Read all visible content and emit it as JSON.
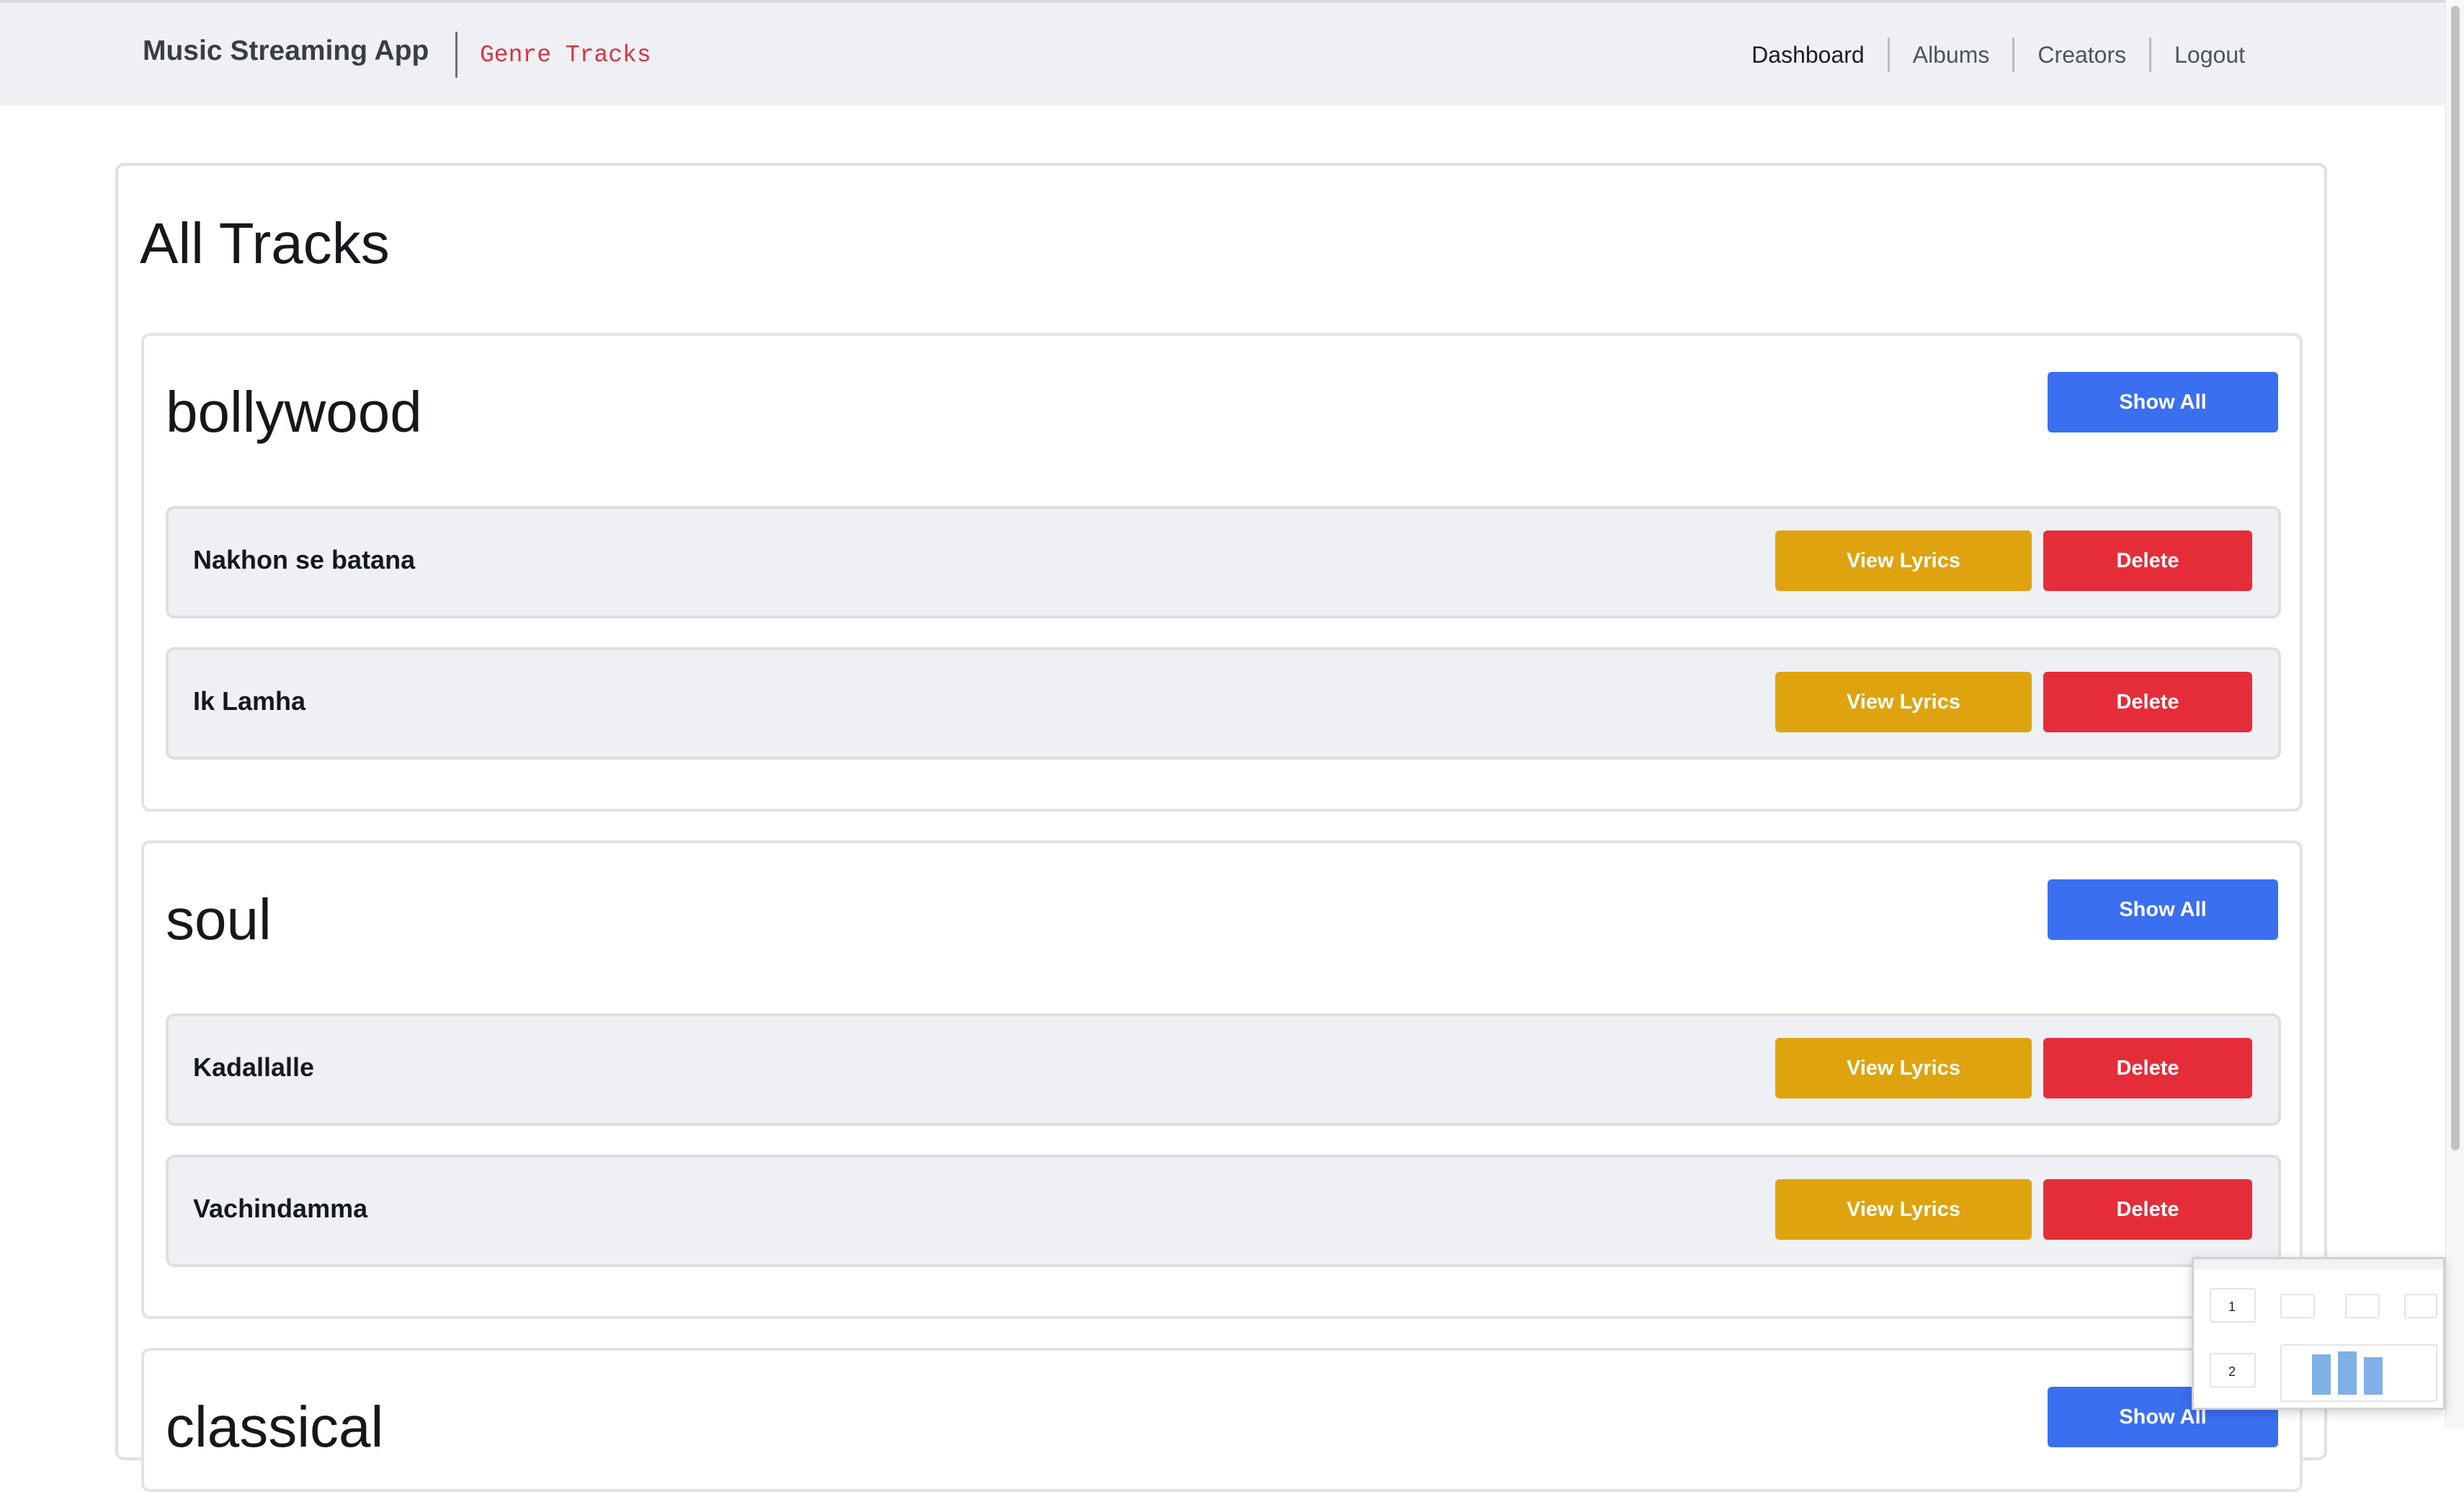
{
  "navbar": {
    "brand": "Music Streaming App",
    "page_code": "Genre Tracks",
    "links": [
      "Dashboard",
      "Albums",
      "Creators",
      "Logout"
    ]
  },
  "page": {
    "title": "All Tracks"
  },
  "genres": [
    {
      "name": "bollywood",
      "show_all_label": "Show All",
      "tracks": [
        {
          "name": "Nakhon se batana",
          "view_label": "View Lyrics",
          "delete_label": "Delete"
        },
        {
          "name": "Ik Lamha",
          "view_label": "View Lyrics",
          "delete_label": "Delete"
        }
      ]
    },
    {
      "name": "soul",
      "show_all_label": "Show All",
      "tracks": [
        {
          "name": "Kadallalle",
          "view_label": "View Lyrics",
          "delete_label": "Delete"
        },
        {
          "name": "Vachindamma",
          "view_label": "View Lyrics",
          "delete_label": "Delete"
        }
      ]
    },
    {
      "name": "classical",
      "show_all_label": "Show All",
      "tracks": []
    }
  ],
  "thumbnail": {
    "values": [
      "1",
      "2"
    ]
  },
  "colors": {
    "primary": "#3a6ff0",
    "warning": "#dea30f",
    "danger": "#e52d3a",
    "page_code": "#d63344"
  }
}
